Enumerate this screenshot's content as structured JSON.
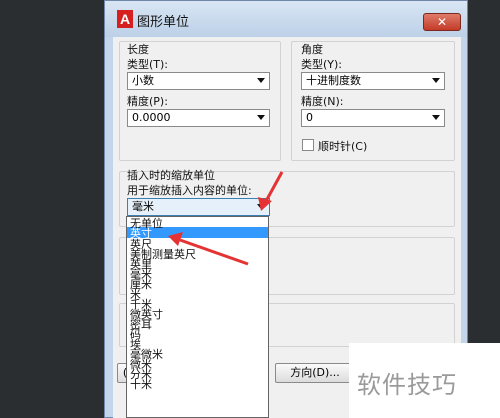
{
  "window": {
    "title": "图形单位",
    "app_icon_letter": "A"
  },
  "length": {
    "heading": "长度",
    "type_label": "类型(T):",
    "type_value": "小数",
    "precision_label": "精度(P):",
    "precision_value": "0.0000"
  },
  "angle": {
    "heading": "角度",
    "type_label": "类型(Y):",
    "type_value": "十进制度数",
    "precision_label": "精度(N):",
    "precision_value": "0",
    "clockwise_label": "顺时针(C)"
  },
  "insertion": {
    "heading": "插入时的缩放单位",
    "sublabel": "用于缩放插入内容的单位:",
    "value": "毫米",
    "options": [
      "无单位",
      "英寸",
      "英尺",
      "美制测量英尺",
      "英里",
      "毫米",
      "厘米",
      "米",
      "千米",
      "微英寸",
      "密耳",
      "码",
      "埃",
      "毫微米",
      "微米",
      "分米",
      "十米"
    ],
    "selected_index": 1
  },
  "buttons": {
    "direction": "方向(D)...",
    "first_partial": "("
  },
  "watermark": "软件技巧",
  "colors": {
    "accent": "#3399ff",
    "annotation": "#e53232",
    "titlebar": "#c3d5ea"
  }
}
